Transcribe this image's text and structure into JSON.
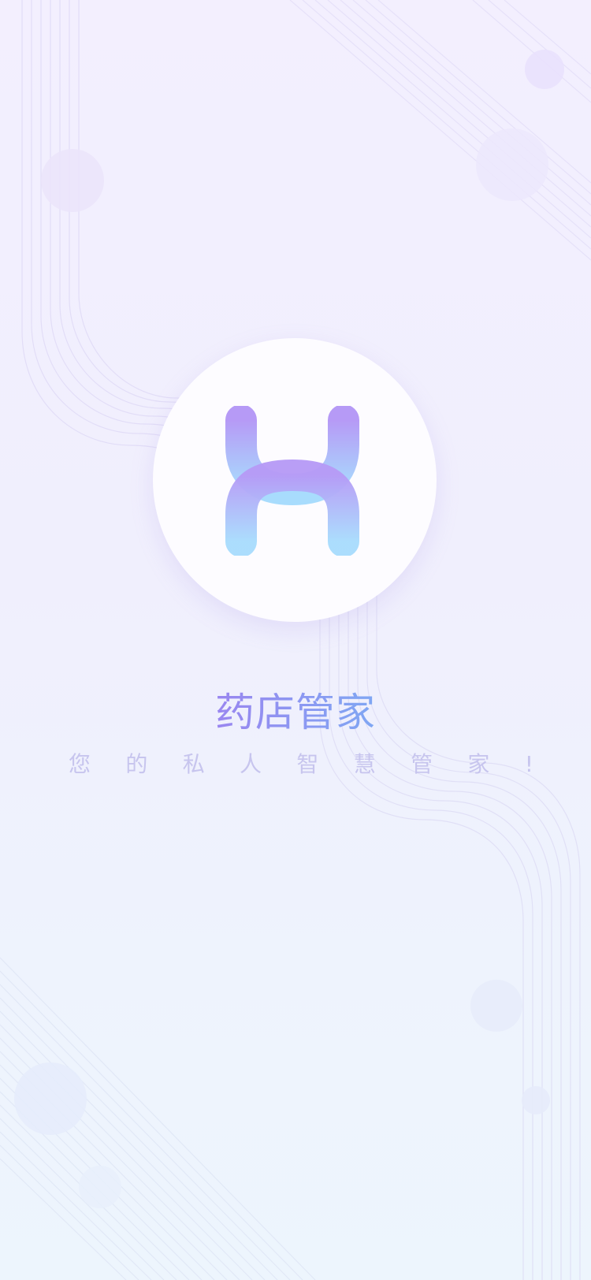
{
  "app": {
    "title": "药店管家",
    "slogan_chars": [
      "您",
      "的",
      "私",
      "人",
      "智",
      "慧",
      "管",
      "家",
      "!"
    ]
  },
  "logo": {
    "icon": "h-logo-icon",
    "gradient_top": "#b69af6",
    "gradient_bottom": "#a8dcfd"
  },
  "colors": {
    "title_start": "#9a86f0",
    "title_end": "#7fa7f3",
    "slogan": "#c7c5ee",
    "background_top": "#f3effe",
    "background_bottom": "#edf5fd"
  }
}
